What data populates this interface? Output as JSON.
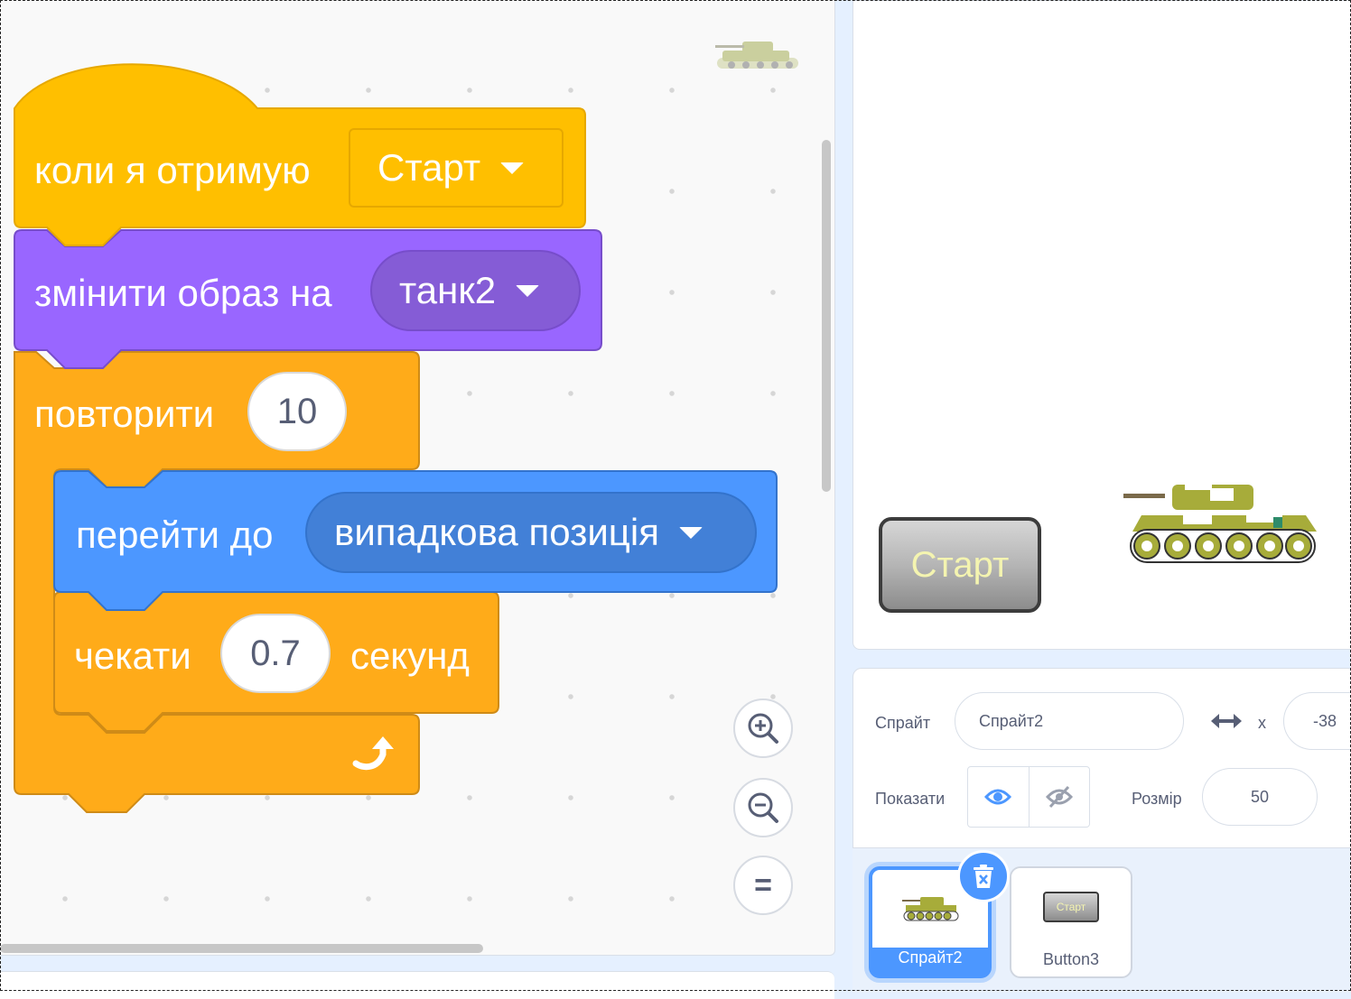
{
  "blocks": {
    "hat": {
      "label": "коли я отримую",
      "message": "Старт"
    },
    "switch_costume": {
      "label": "змінити образ на",
      "costume": "танк2"
    },
    "repeat": {
      "label": "повторити",
      "count": "10"
    },
    "go_to": {
      "label": "перейти до",
      "target": "випадкова позиція"
    },
    "wait": {
      "label": "чекати",
      "seconds": "0.7",
      "unit": "секунд"
    }
  },
  "zoom": {
    "in_icon": "zoom-in-icon",
    "out_icon": "zoom-out-icon",
    "reset_icon": "zoom-reset-icon",
    "reset_glyph": "="
  },
  "stage": {
    "button_label": "Старт"
  },
  "sprite_info": {
    "sprite_label": "Спрайт",
    "sprite_name": "Спрайт2",
    "x_label": "x",
    "x_value": "-38",
    "show_label": "Показати",
    "size_label": "Розмір",
    "size_value": "50"
  },
  "sprite_list": {
    "items": [
      {
        "name": "Спрайт2",
        "selected": true
      },
      {
        "name": "Button3",
        "selected": false,
        "thumb_text": "Старт"
      }
    ]
  },
  "colors": {
    "events": "#ffbf00",
    "looks": "#9966ff",
    "control": "#ffab19",
    "motion": "#4c97ff",
    "accent": "#4c97ff"
  }
}
